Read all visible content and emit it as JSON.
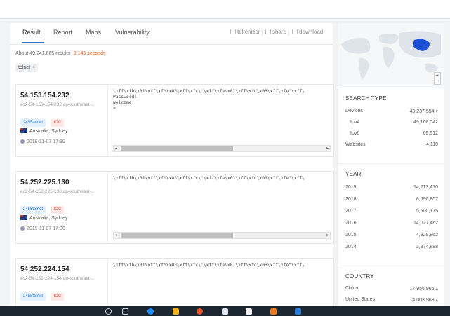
{
  "tabs": [
    {
      "label": "Result"
    },
    {
      "label": "Report"
    },
    {
      "label": "Maps"
    },
    {
      "label": "Vulnerability"
    }
  ],
  "tools": [
    {
      "label": "tokenizer"
    },
    {
      "label": "share"
    },
    {
      "label": "download"
    }
  ],
  "summary": {
    "results": "About 49,241,665 results",
    "time": "0.145 seconds"
  },
  "filter": {
    "label": "telnet",
    "close": "×"
  },
  "results": [
    {
      "ip": "54.153.154.232",
      "host": "ec2-54-153-154-232.ap-southeast-...",
      "port_badge": "2455telnet",
      "ioc_badge": "IOC",
      "location": "Australia, Sydney",
      "date": "2019-11-07 17:30",
      "banner": "\\xff\\xfb\\x01\\xff\\xfb\\x03\\xff\\xfc\\'\\xff\\xfe\\x01\\xff\\xfd\\x03\\xff\\xfe\"\\xff\\\nPassword:\nwelcome\n>"
    },
    {
      "ip": "54.252.225.130",
      "host": "ec2-54-252-225-130.ap-southeast-...",
      "port_badge": "2455telnet",
      "ioc_badge": "IOC",
      "location": "Australia, Sydney",
      "date": "2019-11-07 17:30",
      "banner": "\\xff\\xfb\\x01\\xff\\xfb\\x03\\xff\\xfc\\'\\xff\\xfe\\x01\\xff\\xfd\\x03\\xff\\xfe\"\\xff\\"
    },
    {
      "ip": "54.252.224.154",
      "host": "ec2-54-252-224-154.ap-southeast-...",
      "port_badge": "2455telnet",
      "ioc_badge": "IOC",
      "banner": "\\xff\\xfb\\x01\\xff\\xfb\\x03\\xff\\xfc\\'\\xff\\xfe\\x01\\xff\\xfd\\x03\\xff\\xfe\"\\xff\\"
    }
  ],
  "search_type": {
    "title": "SEARCH TYPE",
    "rows": [
      {
        "label": "Devices",
        "value": "49,237,554 ▾"
      },
      {
        "label": "Ipv4",
        "value": "49,168,042"
      },
      {
        "label": "Ipv6",
        "value": "69,512"
      },
      {
        "label": "Websites",
        "value": "4,110"
      }
    ]
  },
  "year": {
    "title": "YEAR",
    "rows": [
      {
        "label": "2019",
        "value": "14,213,470"
      },
      {
        "label": "2018",
        "value": "6,596,807"
      },
      {
        "label": "2017",
        "value": "5,500,175"
      },
      {
        "label": "2016",
        "value": "14,027,462"
      },
      {
        "label": "2015",
        "value": "4,928,862"
      },
      {
        "label": "2014",
        "value": "3,974,888"
      }
    ]
  },
  "country": {
    "title": "COUNTRY",
    "rows": [
      {
        "label": "China",
        "value": "17,956,965 ▴"
      },
      {
        "label": "United States",
        "value": "4,003,963 ▴"
      }
    ]
  },
  "map": {
    "zoom_in": "+",
    "zoom_out": "−"
  },
  "colors": {
    "accent": "#2d7be5",
    "time": "#e8541a",
    "ioc": "#e0463a",
    "highlight_country": "#1a4fd6"
  }
}
